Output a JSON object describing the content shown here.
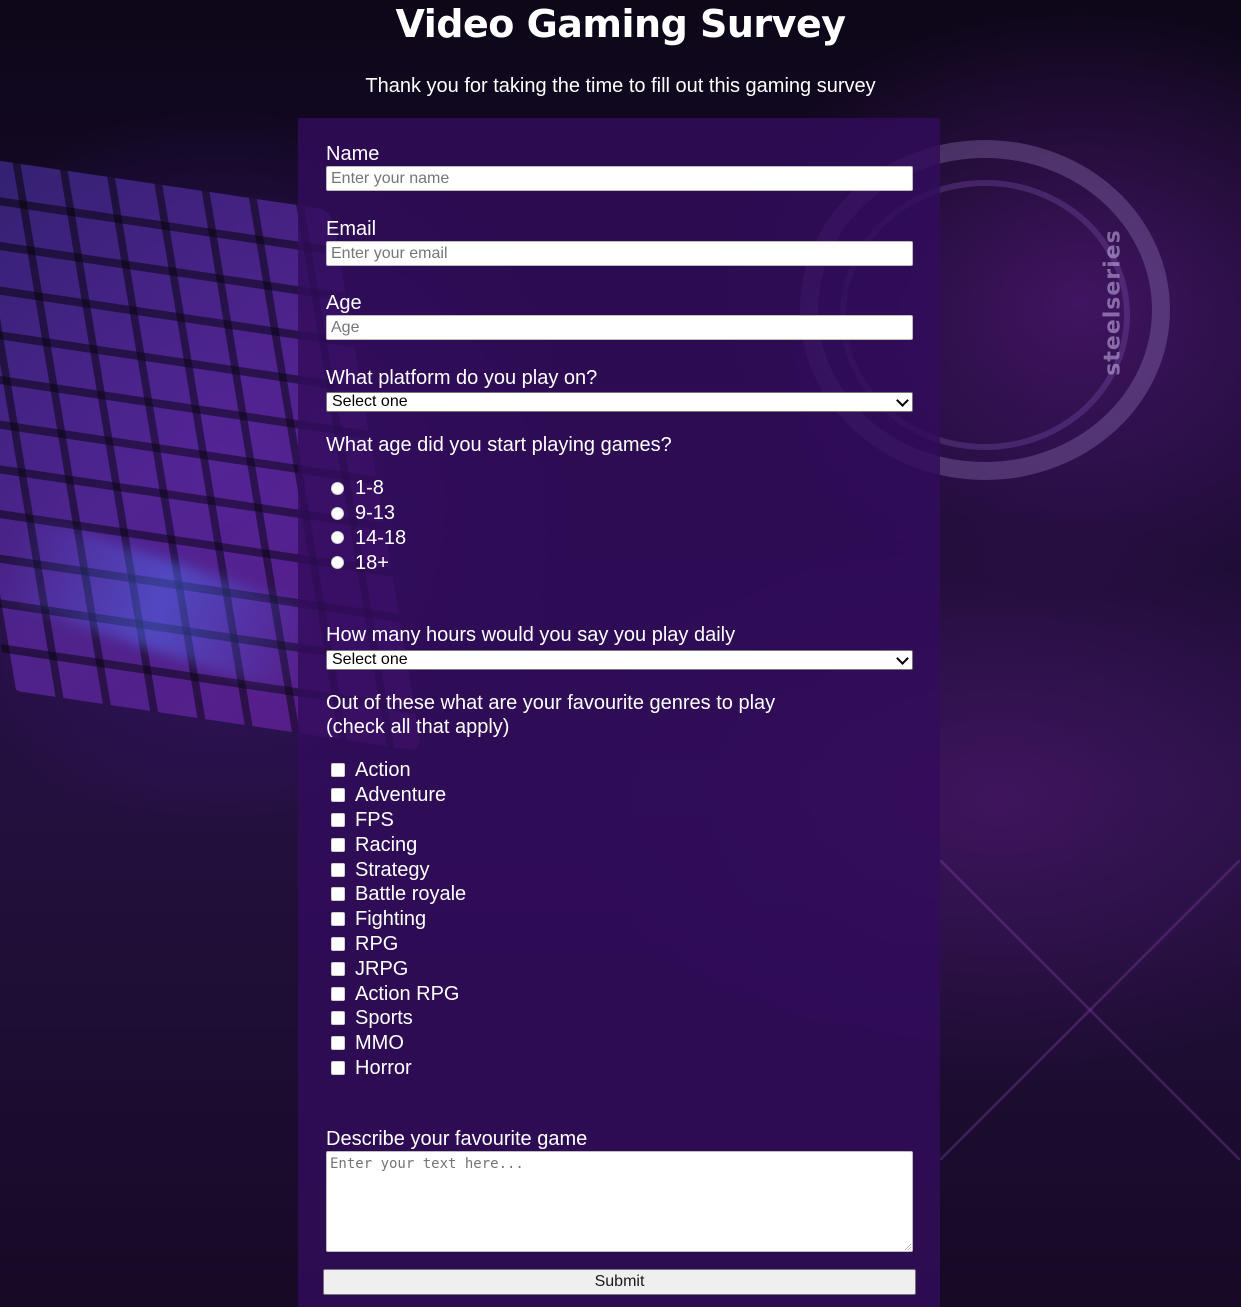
{
  "page": {
    "title": "Video Gaming Survey",
    "description": "Thank you for taking the time to fill out this gaming survey"
  },
  "background": {
    "brand_text": "steelseries"
  },
  "form": {
    "name": {
      "label": "Name",
      "placeholder": "Enter your name"
    },
    "email": {
      "label": "Email",
      "placeholder": "Enter your email"
    },
    "age": {
      "label": "Age",
      "placeholder": "Age"
    },
    "platform": {
      "label": "What platform do you play on?",
      "selected": "Select one"
    },
    "start_age": {
      "label": "What age did you start playing games?",
      "options": [
        "1-8",
        "9-13",
        "14-18",
        "18+"
      ]
    },
    "hours": {
      "label": "How many hours would you say you play daily",
      "selected": "Select one"
    },
    "genres": {
      "label_line1": "Out of these what are your favourite genres to play",
      "label_line2": "(check all that apply)",
      "options": [
        "Action",
        "Adventure",
        "FPS",
        "Racing",
        "Strategy",
        "Battle royale",
        "Fighting",
        "RPG",
        "JRPG",
        "Action RPG",
        "Sports",
        "MMO",
        "Horror"
      ]
    },
    "favourite_game": {
      "label": "Describe your favourite game",
      "placeholder": "Enter your text here..."
    },
    "submit_label": "Submit"
  },
  "colors": {
    "form_panel": "#320c5c",
    "page_bg": "#1a0a2c",
    "text": "#ffffff"
  }
}
